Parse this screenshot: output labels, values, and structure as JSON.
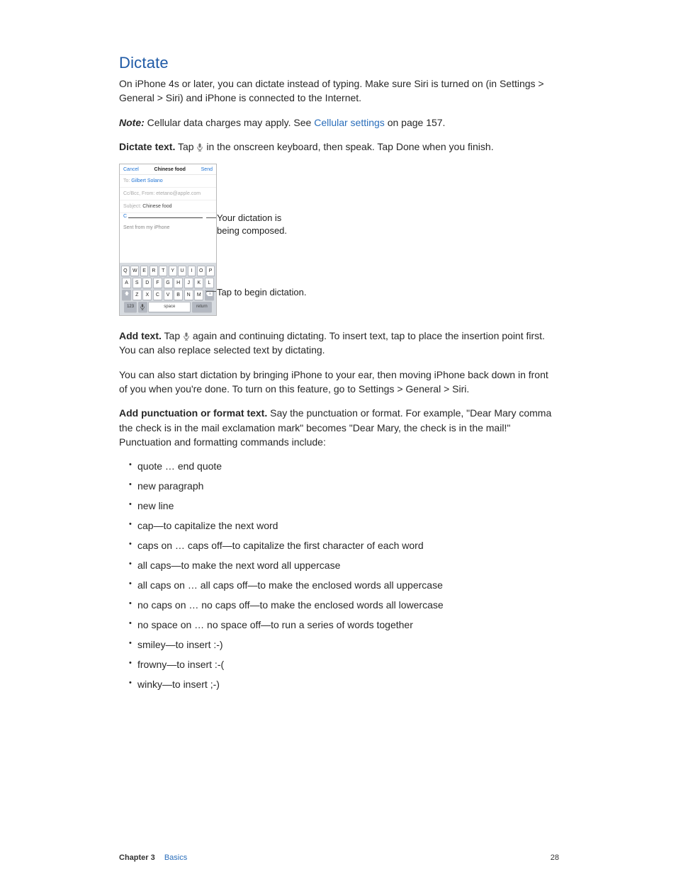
{
  "heading": "Dictate",
  "intro": "On iPhone 4s or later, you can dictate instead of typing. Make sure Siri is turned on (in Settings > General > Siri) and iPhone is connected to the Internet.",
  "note_label": "Note:",
  "note_text_a": "  Cellular data charges may apply. See ",
  "note_link": "Cellular settings",
  "note_text_b": " on page 157.",
  "dictate_text": {
    "label": "Dictate text.",
    "before": " Tap ",
    "after": " in the onscreen keyboard, then speak. Tap Done when you finish."
  },
  "figure": {
    "header": {
      "cancel": "Cancel",
      "title": "Chinese food",
      "send": "Send"
    },
    "to_label": "To:",
    "to_value": "Gilbert Solano",
    "cc_line": "Cc/Bcc, From: etetano@apple.com",
    "subject_label": "Subject:",
    "subject_value": "Chinese food",
    "body_prefix": "C",
    "signature": "Sent from my iPhone",
    "keyboard": {
      "row1": [
        "Q",
        "W",
        "E",
        "R",
        "T",
        "Y",
        "U",
        "I",
        "O",
        "P"
      ],
      "row2": [
        "A",
        "S",
        "D",
        "F",
        "G",
        "H",
        "J",
        "K",
        "L"
      ],
      "row3": [
        "Z",
        "X",
        "C",
        "V",
        "B",
        "N",
        "M"
      ],
      "num": "123",
      "space": "space",
      "return": "return"
    },
    "callout_compose_1": "Your dictation is",
    "callout_compose_2": "being composed.",
    "callout_mic": "Tap to begin dictation."
  },
  "add_text": {
    "label": "Add text.",
    "before": " Tap ",
    "after": " again and continuing dictating. To insert text, tap to place the insertion point first. You can also replace selected text by dictating."
  },
  "ear_para": "You can also start dictation by bringing iPhone to your ear, then moving iPhone back down in front of you when you're done. To turn on this feature, go to Settings > General > Siri.",
  "punct": {
    "label": "Add punctuation or format text.",
    "text": " Say the punctuation or format. For example, \"Dear Mary comma the check is in the mail exclamation mark\" becomes \"Dear Mary, the check is in the mail!\" Punctuation and formatting commands include:"
  },
  "commands": [
    "quote … end quote",
    "new paragraph",
    "new line",
    "cap—to capitalize the next word",
    "caps on … caps off—to capitalize the first character of each word",
    "all caps—to make the next word all uppercase",
    "all caps on … all caps off—to make the enclosed words all uppercase",
    "no caps on … no caps off—to make the enclosed words all lowercase",
    "no space on … no space off—to run a series of words together",
    "smiley—to insert :-)",
    "frowny—to insert :-(",
    "winky—to insert ;-)"
  ],
  "footer": {
    "chapter_label": "Chapter 3",
    "chapter_name": "Basics",
    "page": "28"
  }
}
